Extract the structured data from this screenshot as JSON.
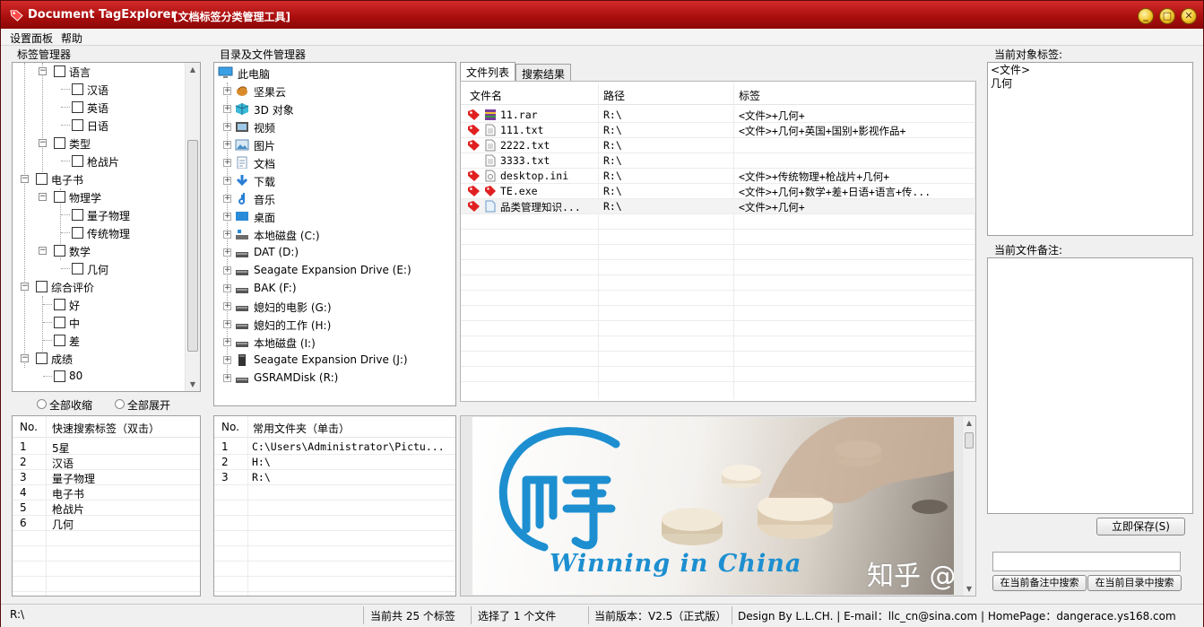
{
  "window": {
    "title": "Document TagExplorer",
    "subtitle": "[文档标签分类管理工具]",
    "controls": {
      "minimize": "_",
      "maximize": "□",
      "close": "✕"
    }
  },
  "menu": {
    "items": [
      "设置面板",
      "帮助"
    ]
  },
  "tag_manager": {
    "label": "标签管理器",
    "nodes": [
      {
        "label": "语言",
        "level": 1,
        "expander": "⊟"
      },
      {
        "label": "汉语",
        "level": 2
      },
      {
        "label": "英语",
        "level": 2
      },
      {
        "label": "日语",
        "level": 2
      },
      {
        "label": "类型",
        "level": 1,
        "expander": "⊟"
      },
      {
        "label": "枪战片",
        "level": 2
      },
      {
        "label": "电子书",
        "level": 0,
        "expander": "⊟"
      },
      {
        "label": "物理学",
        "level": 1,
        "expander": "⊟"
      },
      {
        "label": "量子物理",
        "level": 2
      },
      {
        "label": "传统物理",
        "level": 2
      },
      {
        "label": "数学",
        "level": 1,
        "expander": "⊟"
      },
      {
        "label": "几何",
        "level": 2
      },
      {
        "label": "综合评价",
        "level": 0,
        "expander": "⊟"
      },
      {
        "label": "好",
        "level": 1
      },
      {
        "label": "中",
        "level": 1
      },
      {
        "label": "差",
        "level": 1
      },
      {
        "label": "成绩",
        "level": 0,
        "expander": "⊟"
      },
      {
        "label": "80",
        "level": 1
      }
    ],
    "collapse_all": "全部收缩",
    "expand_all": "全部展开"
  },
  "quick_search": {
    "col_no": "No.",
    "col_tag": "快速搜索标签（双击）",
    "rows": [
      {
        "no": "1",
        "tag": "5星"
      },
      {
        "no": "2",
        "tag": "汉语"
      },
      {
        "no": "3",
        "tag": "量子物理"
      },
      {
        "no": "4",
        "tag": "电子书"
      },
      {
        "no": "5",
        "tag": "枪战片"
      },
      {
        "no": "6",
        "tag": "几何"
      }
    ]
  },
  "folder_manager": {
    "label": "目录及文件管理器",
    "root": "此电脑",
    "items": [
      {
        "label": "坚果云",
        "icon": "nut-cloud-icon"
      },
      {
        "label": "3D 对象",
        "icon": "3d-objects-icon"
      },
      {
        "label": "视频",
        "icon": "video-folder-icon"
      },
      {
        "label": "图片",
        "icon": "picture-folder-icon"
      },
      {
        "label": "文档",
        "icon": "document-folder-icon"
      },
      {
        "label": "下载",
        "icon": "download-folder-icon"
      },
      {
        "label": "音乐",
        "icon": "music-folder-icon"
      },
      {
        "label": "桌面",
        "icon": "desktop-folder-icon"
      },
      {
        "label": "本地磁盘 (C:)",
        "icon": "system-drive-icon"
      },
      {
        "label": "DAT (D:)",
        "icon": "drive-icon"
      },
      {
        "label": "Seagate Expansion Drive (E:)",
        "icon": "drive-icon"
      },
      {
        "label": "BAK (F:)",
        "icon": "drive-icon"
      },
      {
        "label": "媳妇的电影 (G:)",
        "icon": "drive-icon"
      },
      {
        "label": "媳妇的工作 (H:)",
        "icon": "drive-icon"
      },
      {
        "label": "本地磁盘 (I:)",
        "icon": "drive-icon"
      },
      {
        "label": "Seagate Expansion Drive (J:)",
        "icon": "external-drive-icon"
      },
      {
        "label": "GSRAMDisk (R:)",
        "icon": "drive-icon"
      }
    ]
  },
  "common_folders": {
    "col_no": "No.",
    "col_path": "常用文件夹（单击）",
    "rows": [
      {
        "no": "1",
        "path": "C:\\Users\\Administrator\\Pictu..."
      },
      {
        "no": "2",
        "path": "H:\\"
      },
      {
        "no": "3",
        "path": "R:\\"
      }
    ]
  },
  "file_panel": {
    "tabs": [
      "文件列表",
      "搜索结果"
    ],
    "columns": {
      "name": "文件名",
      "path": "路径",
      "tags": "标签"
    },
    "rows": [
      {
        "tagged": true,
        "icon": "rar-file-icon",
        "name": "11.rar",
        "path": "R:\\",
        "tags": "<文件>+几何+"
      },
      {
        "tagged": true,
        "icon": "text-file-icon",
        "name": "111.txt",
        "path": "R:\\",
        "tags": "<文件>+几何+英国+国别+影视作品+"
      },
      {
        "tagged": true,
        "icon": "text-file-icon",
        "name": "2222.txt",
        "path": "R:\\",
        "tags": ""
      },
      {
        "tagged": false,
        "icon": "text-file-icon",
        "name": "3333.txt",
        "path": "R:\\",
        "tags": ""
      },
      {
        "tagged": true,
        "icon": "ini-file-icon",
        "name": "desktop.ini",
        "path": "R:\\",
        "tags": "<文件>+传统物理+枪战片+几何+"
      },
      {
        "tagged": true,
        "icon": "tag-app-icon",
        "name": "TE.exe",
        "path": "R:\\",
        "tags": "<文件>+几何+数学+差+日语+语言+传..."
      },
      {
        "tagged": true,
        "icon": "document-file-icon",
        "name": "品类管理知识...",
        "path": "R:\\",
        "tags": "<文件>+几何+"
      }
    ]
  },
  "preview": {
    "logo_text": "Winning in China",
    "watermark": "知乎 @dangerace"
  },
  "current_tags": {
    "label": "当前对象标签:",
    "lines": [
      "<文件>",
      "几何"
    ]
  },
  "current_note": {
    "label": "当前文件备注:",
    "save_button": "立即保存(S)"
  },
  "search": {
    "button_notes": "在当前备注中搜索",
    "button_dir": "在当前目录中搜索"
  },
  "status": {
    "path": "R:\\",
    "tag_count": "当前共 25 个标签",
    "selected": "选择了 1 个文件",
    "version": "当前版本：V2.5（正式版）",
    "credits": "Design By L.L.CH. | E-mail：llc_cn@sina.com | HomePage：dangerace.ys168.com"
  },
  "colors": {
    "title_bar": "#a80d0d",
    "tag_red": "#e02020",
    "logo_blue": "#1d8fd0"
  }
}
